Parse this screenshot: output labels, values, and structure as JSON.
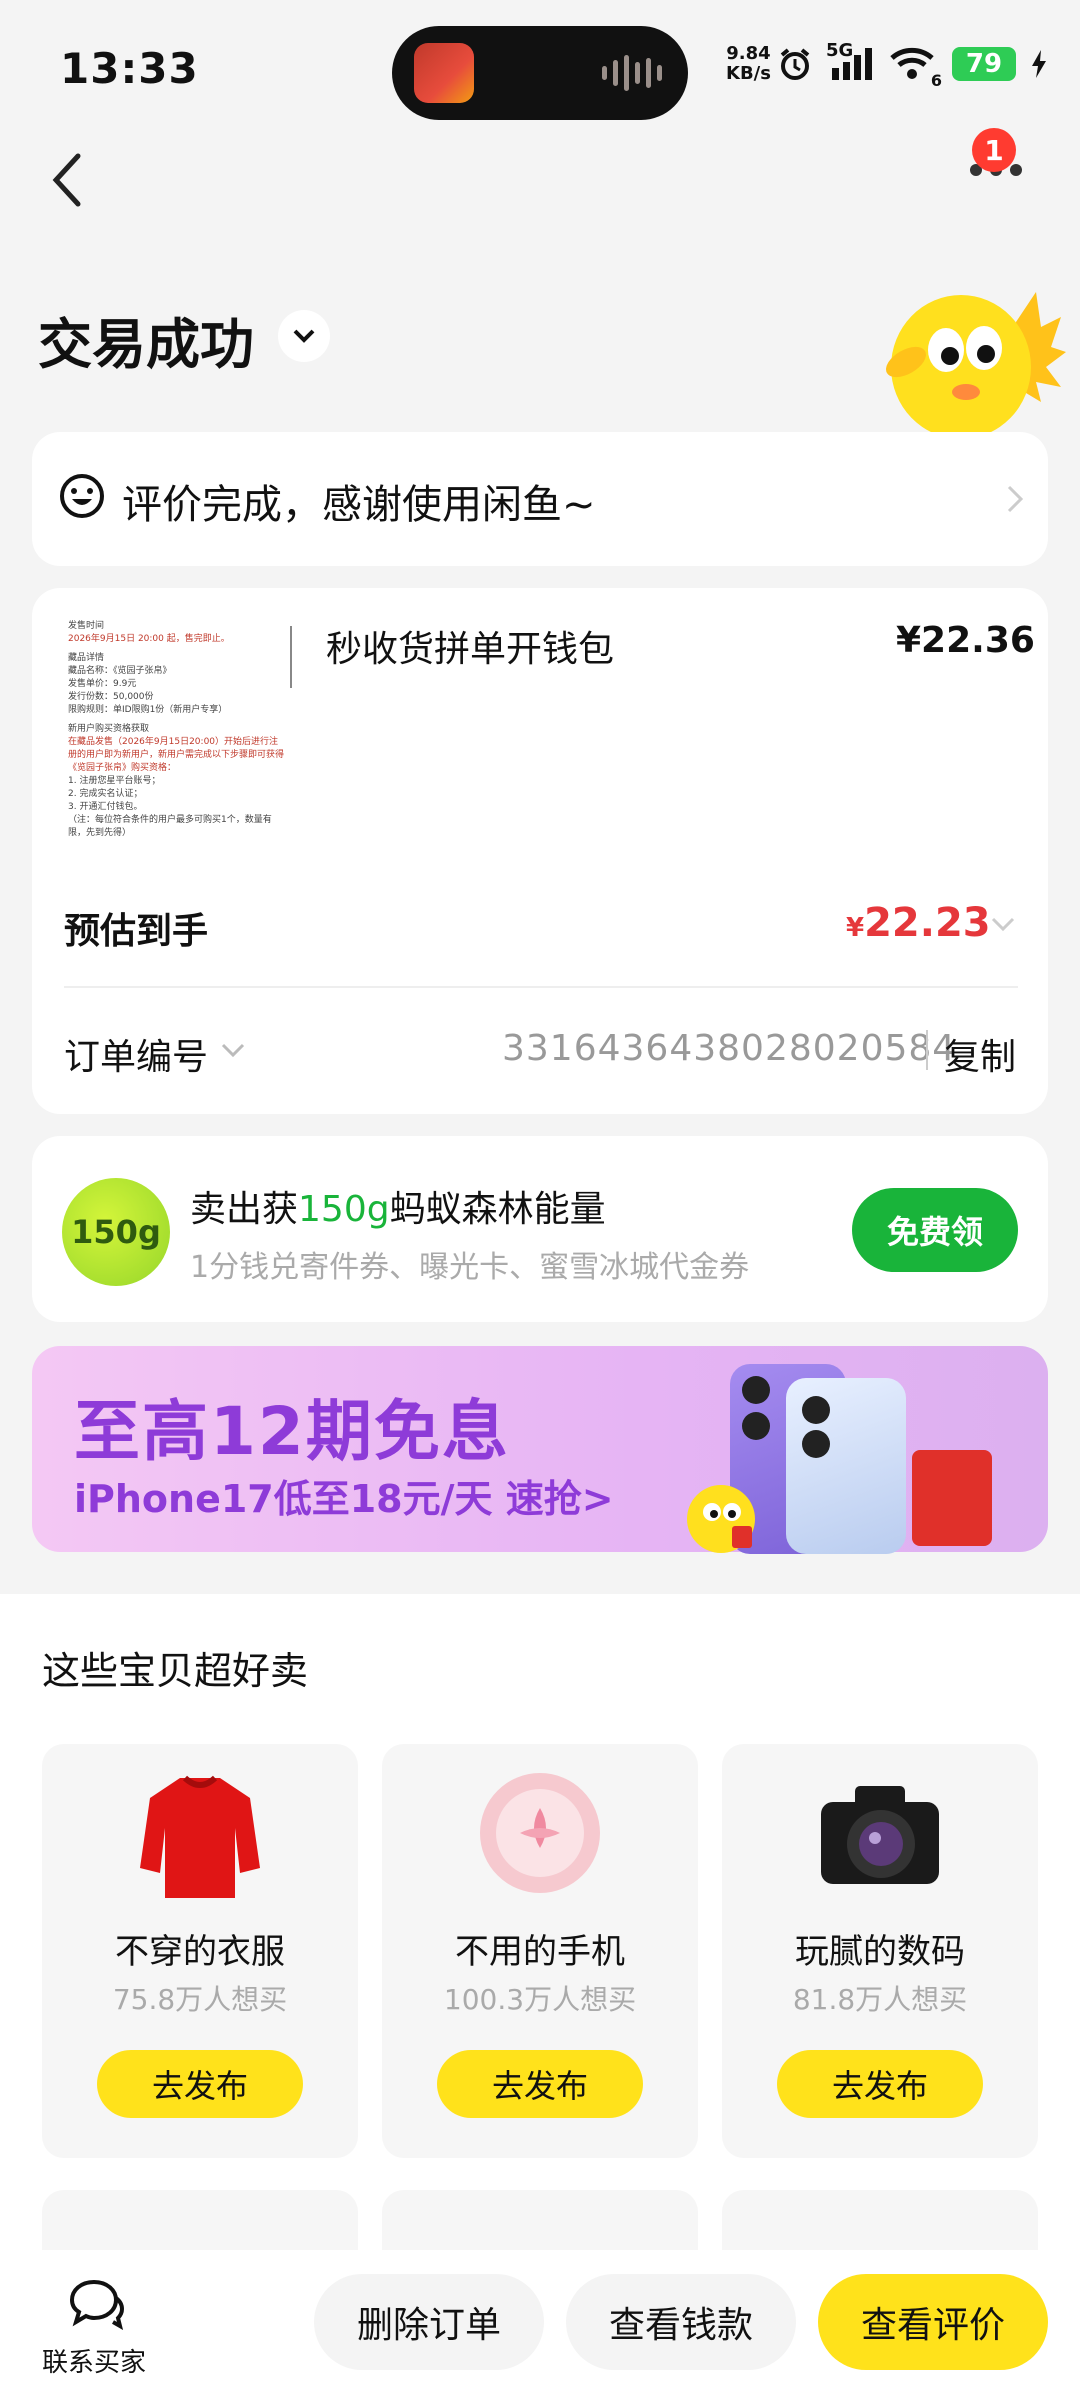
{
  "status_bar": {
    "time": "13:33",
    "net_speed_value": "9.84",
    "net_speed_unit": "KB/s",
    "network": "5G",
    "battery": "79",
    "wifi_sub": "6"
  },
  "header": {
    "notification_count": "1",
    "title": "交易成功"
  },
  "evaluation": {
    "text": "评价完成，感谢使用闲鱼~"
  },
  "order": {
    "product_title": "秒收货拼单开钱包",
    "product_price": "¥22.36",
    "estimated_label": "预估到手",
    "estimated_currency": "¥",
    "estimated_value": "22.23",
    "order_no_label": "订单编号",
    "order_no": "3316436438028020584",
    "copy_label": "复制",
    "thumb_lines": [
      "发售时间",
      "2026年9月15日 20:00 起，售完即止。",
      "藏品详情",
      "藏品名称：《览园子张帛》",
      "发售单价：9.9元",
      "发行份数：50,000份",
      "限购规则：单ID限购1份（新用户专享）",
      "新用户购买资格获取",
      "在藏品发售（2026年9月15日20:00）开始后进行注册的用户即为新用户，新用户需完成以下步骤即可获得《览园子张帛》购买资格：",
      "1. 注册您星平台账号；",
      "2. 完成实名认证；",
      "3. 开通汇付钱包。",
      "（注：每位符合条件的用户最多可购买1个，数量有限，先到先得）"
    ]
  },
  "ant_forest": {
    "badge": "150g",
    "title_pre": "卖出获",
    "title_highlight": "150g",
    "title_post": "蚂蚁森林能量",
    "subtitle": "1分钱兑寄件券、曝光卡、蜜雪冰城代金券",
    "button": "免费领"
  },
  "banner": {
    "headline": "至高12期免息",
    "subline": "iPhone17低至18元/天  速抢>"
  },
  "recommend": {
    "title": "这些宝贝超好卖",
    "items": [
      {
        "name": "不穿的衣服",
        "want": "75.8万人想买",
        "button": "去发布"
      },
      {
        "name": "不用的手机",
        "want": "100.3万人想买",
        "button": "去发布"
      },
      {
        "name": "玩腻的数码",
        "want": "81.8万人想买",
        "button": "去发布"
      }
    ]
  },
  "bottom_bar": {
    "contact": "联系买家",
    "delete": "删除订单",
    "view_money": "查看钱款",
    "view_review": "查看评价"
  },
  "colors": {
    "accent_yellow": "#ffe21b",
    "price_red": "#e5373b",
    "green": "#19b43a",
    "banner_purple": "#8e3bd8"
  }
}
